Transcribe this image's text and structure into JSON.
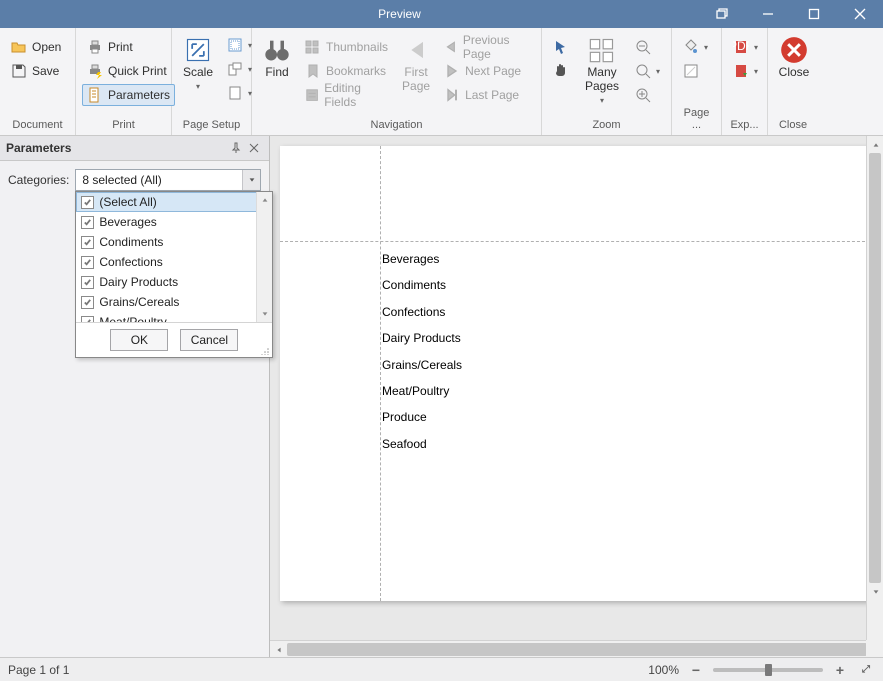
{
  "window": {
    "title": "Preview"
  },
  "ribbon": {
    "document": {
      "label": "Document",
      "open": "Open",
      "save": "Save"
    },
    "print": {
      "label": "Print",
      "print": "Print",
      "quick": "Quick Print",
      "parameters": "Parameters"
    },
    "pagesetup": {
      "label": "Page Setup",
      "scale": "Scale"
    },
    "navigation": {
      "label": "Navigation",
      "find": "Find",
      "thumbnails": "Thumbnails",
      "bookmarks": "Bookmarks",
      "editing": "Editing Fields",
      "firstpage": "First\nPage",
      "prev": "Previous Page",
      "next": "Next  Page",
      "last": "Last  Page"
    },
    "zoom": {
      "label": "Zoom",
      "many": "Many Pages"
    },
    "page": {
      "label": "Page ..."
    },
    "export": {
      "label": "Exp..."
    },
    "close": {
      "label": "Close",
      "btn": "Close"
    }
  },
  "panel": {
    "title": "Parameters",
    "categories_label": "Categories:",
    "selected": "8 selected (All)",
    "options": [
      "(Select All)",
      "Beverages",
      "Condiments",
      "Confections",
      "Dairy Products",
      "Grains/Cereals",
      "Meat/Poultry"
    ],
    "ok": "OK",
    "cancel": "Cancel"
  },
  "report_items": [
    "Beverages",
    "Condiments",
    "Confections",
    "Dairy Products",
    "Grains/Cereals",
    "Meat/Poultry",
    "Produce",
    "Seafood"
  ],
  "status": {
    "page": "Page 1 of 1",
    "zoom": "100%"
  }
}
